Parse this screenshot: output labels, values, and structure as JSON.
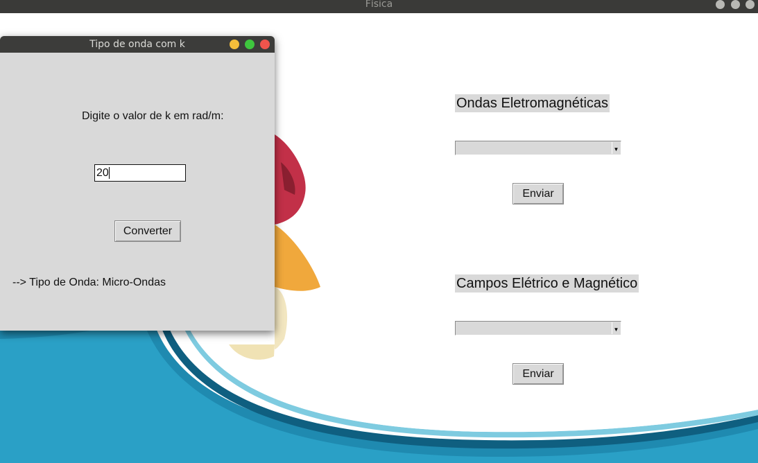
{
  "window": {
    "title": "Física"
  },
  "main": {
    "section1": {
      "label": "Ondas Eletromagnéticas",
      "select_value": "",
      "button_label": "Enviar"
    },
    "section2": {
      "label": "Campos Elétrico e Magnético",
      "select_value": "",
      "button_label": "Enviar"
    }
  },
  "dialog": {
    "title": "Tipo de onda com k",
    "prompt": "Digite o valor de k em rad/m:",
    "input_value": "20",
    "button_label": "Converter",
    "result": "--> Tipo de Onda: Micro-Ondas"
  },
  "colors": {
    "wave_dark": "#1f7fa6",
    "wave_mid": "#2a9cc4",
    "wave_light": "#7ecbe0",
    "dialog_close": "#f0544c",
    "dialog_max": "#3ec63e",
    "dialog_min": "#f5be3a"
  }
}
